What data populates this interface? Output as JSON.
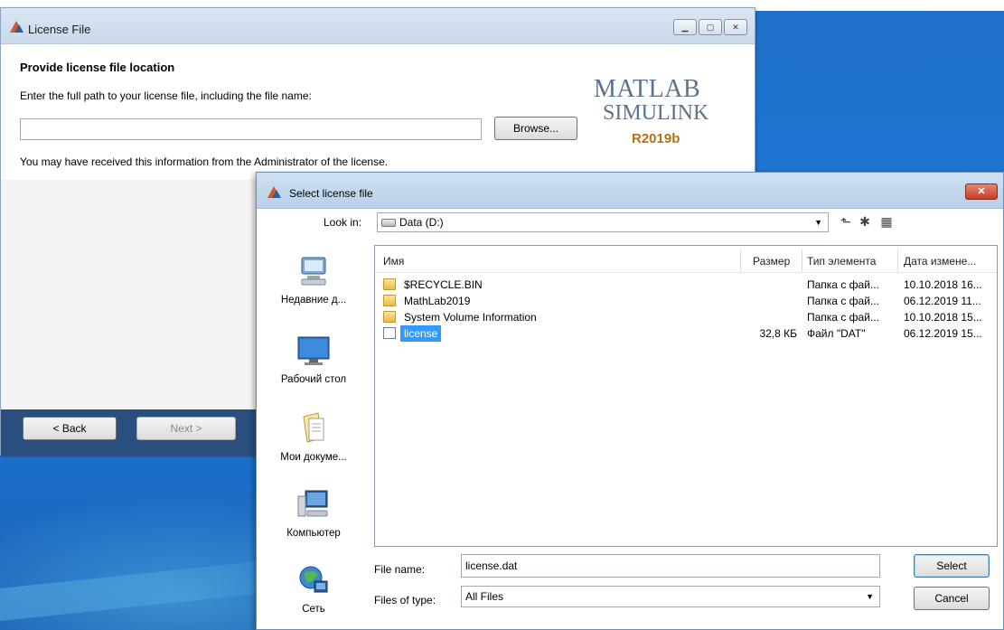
{
  "license_window": {
    "title": "License File",
    "heading": "Provide license file location",
    "prompt": "Enter the full path to your license file, including the file name:",
    "path_value": "",
    "browse_label": "Browse...",
    "info": "You may have received this information from the Administrator of the license.",
    "logo": {
      "line1": "MATLAB",
      "line2": "SIMULINK",
      "version": "R2019b"
    },
    "back_label": "< Back",
    "next_label": "Next >"
  },
  "dialog": {
    "title": "Select license file",
    "look_in_label": "Look in:",
    "look_in_value": "Data (D:)",
    "places": [
      {
        "label": "Недавние д...",
        "icon": "recent-places-icon"
      },
      {
        "label": "Рабочий стол",
        "icon": "desktop-icon"
      },
      {
        "label": "Мои докуме...",
        "icon": "documents-icon"
      },
      {
        "label": "Компьютер",
        "icon": "computer-icon"
      },
      {
        "label": "Сеть",
        "icon": "network-icon"
      }
    ],
    "columns": {
      "name": "Имя",
      "size": "Размер",
      "type": "Тип элемента",
      "date": "Дата измене..."
    },
    "files": [
      {
        "name": "$RECYCLE.BIN",
        "size": "",
        "type": "Папка с фай...",
        "date": "10.10.2018 16...",
        "kind": "folder"
      },
      {
        "name": "MathLab2019",
        "size": "",
        "type": "Папка с фай...",
        "date": "06.12.2019 11...",
        "kind": "folder"
      },
      {
        "name": "System Volume Information",
        "size": "",
        "type": "Папка с фай...",
        "date": "10.10.2018 15...",
        "kind": "folder"
      },
      {
        "name": "license",
        "size": "32,8 КБ",
        "type": "Файл \"DAT\"",
        "date": "06.12.2019 15...",
        "kind": "file",
        "selected": true
      }
    ],
    "file_name_label": "File name:",
    "file_name_value": "license.dat",
    "files_of_type_label": "Files of type:",
    "files_of_type_value": "All Files",
    "select_label": "Select",
    "cancel_label": "Cancel"
  }
}
